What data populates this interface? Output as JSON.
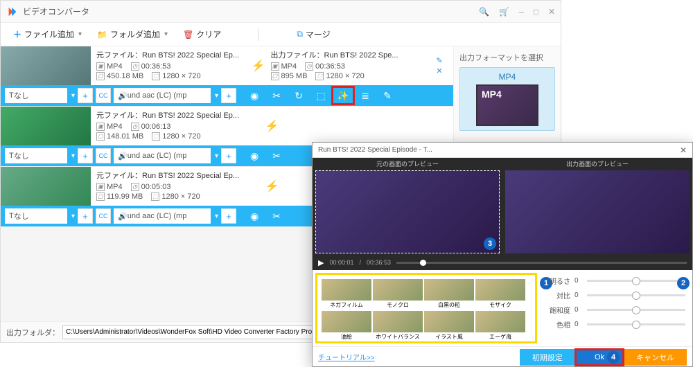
{
  "window": {
    "title": "ビデオコンバータ",
    "min": "–",
    "max": "□",
    "close": "✕",
    "search_icon": "🔍",
    "cart_icon": "🛒"
  },
  "toolbar": {
    "add_file": "ファイル追加",
    "add_folder": "フォルダ追加",
    "clear": "クリア",
    "merge": "マージ"
  },
  "files": [
    {
      "src_label": "元ファイル：Run BTS! 2022 Special Ep...",
      "src_fmt": "MP4",
      "src_dur": "00:36:53",
      "src_size": "450.18 MB",
      "src_res": "1280 × 720",
      "out_label": "出力ファイル：Run BTS! 2022 Spe...",
      "out_fmt": "MP4",
      "out_dur": "00:36:53",
      "out_size": "895 MB",
      "out_res": "1280 × 720",
      "sub": "なし",
      "audio": "und aac (LC) (mp"
    },
    {
      "src_label": "元ファイル：Run BTS! 2022 Special Ep...",
      "src_fmt": "MP4",
      "src_dur": "00:06:13",
      "src_size": "148.01 MB",
      "src_res": "1280 × 720",
      "sub": "なし",
      "audio": "und aac (LC) (mp"
    },
    {
      "src_label": "元ファイル：Run BTS! 2022 Special Ep...",
      "src_fmt": "MP4",
      "src_dur": "00:05:03",
      "src_size": "119.99 MB",
      "src_res": "1280 × 720",
      "sub": "なし",
      "audio": "und aac (LC) (mp"
    }
  ],
  "side": {
    "label": "出力フォーマットを選択",
    "format": "MP4"
  },
  "bottom": {
    "label": "出力フォルダ：",
    "path": "C:\\Users\\Administrator\\Videos\\WonderFox Soft\\HD Video Converter Factory Pro\\OutputVideo\\"
  },
  "effects": {
    "title": "Run BTS! 2022 Special Episode - T...",
    "preview_src": "元の画面のプレビュー",
    "preview_out": "出力画面のプレビュー",
    "time_cur": "00:00:01",
    "time_total": "00:36:53",
    "filters": [
      "ネガフィルム",
      "モノクロ",
      "白黒の粒",
      "モザイク",
      "油絵",
      "ホワイトバランス",
      "イラスト風",
      "エーゲ海"
    ],
    "sliders": {
      "brightness_lbl": "明るさ",
      "brightness_val": "0",
      "contrast_lbl": "対比",
      "contrast_val": "0",
      "saturation_lbl": "飽和度",
      "saturation_val": "0",
      "hue_lbl": "色相",
      "hue_val": "0"
    },
    "tutorial": "チュートリアル>>",
    "reset": "初期設定",
    "ok": "Ok",
    "cancel": "キャンセル"
  }
}
